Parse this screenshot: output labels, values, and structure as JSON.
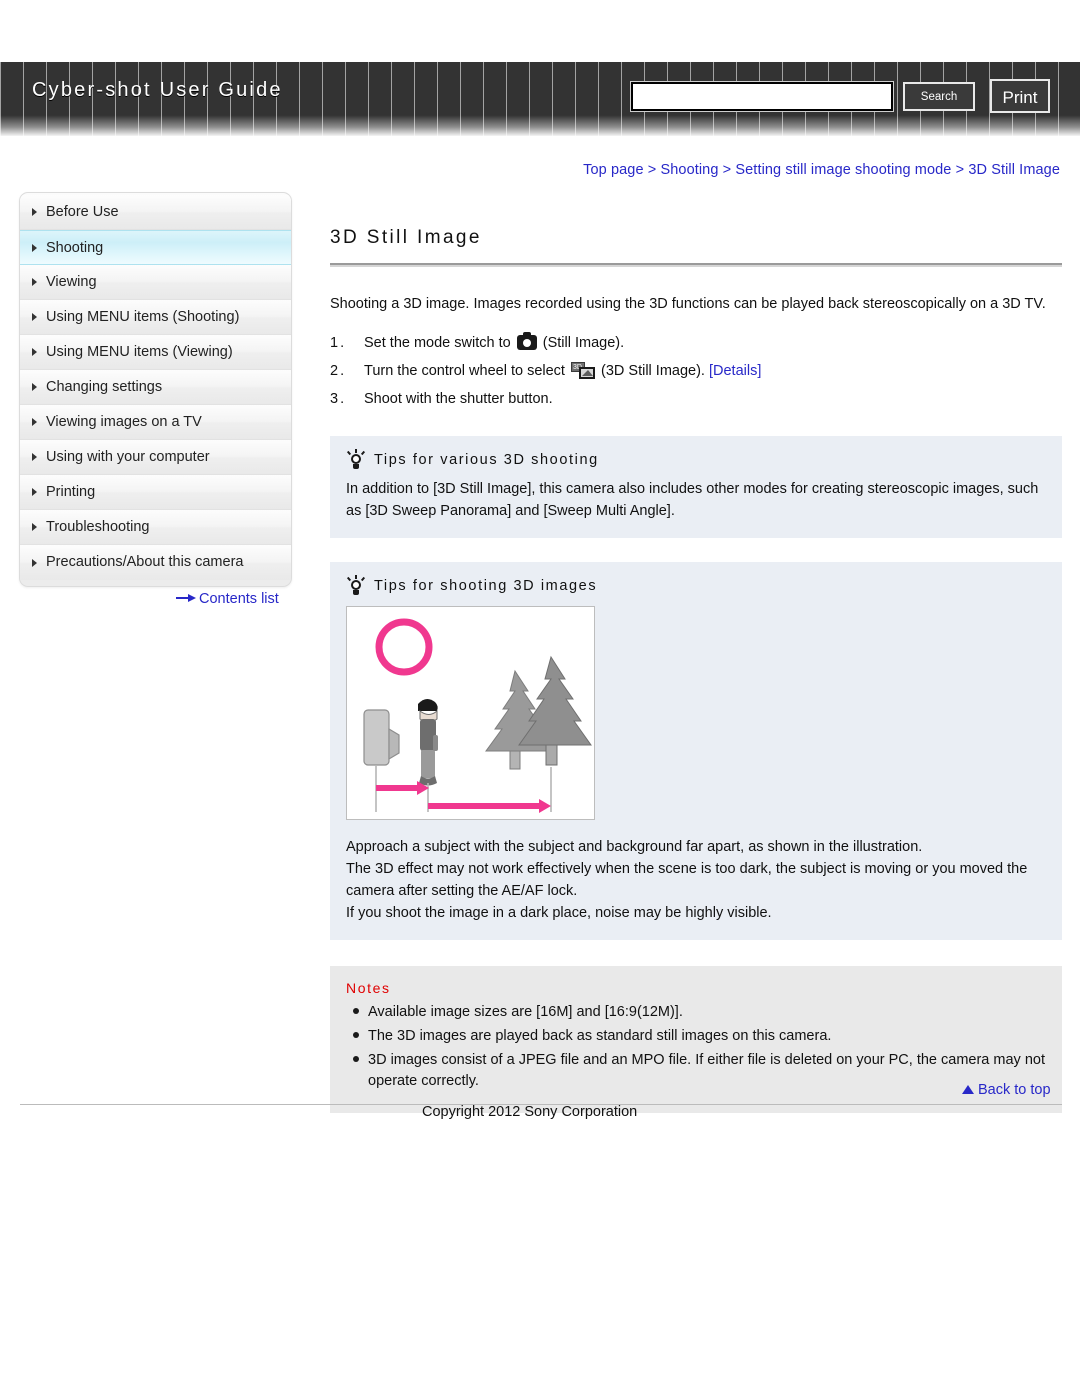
{
  "header": {
    "brand": "Cyber-shot User Guide",
    "search_value": "",
    "search_placeholder": "",
    "search_button": "Search",
    "print_button": "Print"
  },
  "breadcrumb": {
    "items": [
      "Top page",
      "Shooting",
      "Setting still image shooting mode",
      "3D Still Image"
    ],
    "separator": ">"
  },
  "sidebar": {
    "items": [
      {
        "label": "Before Use",
        "active": false
      },
      {
        "label": "Shooting",
        "active": true
      },
      {
        "label": "Viewing",
        "active": false
      },
      {
        "label": "Using MENU items (Shooting)",
        "active": false
      },
      {
        "label": "Using MENU items (Viewing)",
        "active": false
      },
      {
        "label": "Changing settings",
        "active": false
      },
      {
        "label": "Viewing images on a TV",
        "active": false
      },
      {
        "label": "Using with your computer",
        "active": false
      },
      {
        "label": "Printing",
        "active": false
      },
      {
        "label": "Troubleshooting",
        "active": false
      },
      {
        "label": "Precautions/About this camera",
        "active": false
      }
    ],
    "contents_link": "Contents list"
  },
  "main": {
    "title": "3D Still Image",
    "intro": "Shooting a 3D image. Images recorded using the 3D functions can be played back stereoscopically on a 3D TV.",
    "steps": [
      {
        "num": "1.",
        "before_icon": "Set the mode switch to ",
        "icon": "camera-icon",
        "after_icon": " (Still Image).",
        "link": ""
      },
      {
        "num": "2.",
        "before_icon": "Turn the control wheel to select ",
        "icon": "3d-still-image-icon",
        "after_icon": " (3D Still Image). ",
        "link": "[Details]"
      },
      {
        "num": "3.",
        "before_icon": "Shoot with the shutter button.",
        "icon": "",
        "after_icon": "",
        "link": ""
      }
    ],
    "tip1": {
      "heading": "Tips for various 3D shooting",
      "body": "In addition to [3D Still Image], this camera also includes other modes for creating stereoscopic images, such as [3D Sweep Panorama] and [Sweep Multi Angle]."
    },
    "tip2": {
      "heading": "Tips for shooting 3D images",
      "illustration_label": "3d-shooting-distance-illustration",
      "lines": [
        "Approach a subject with the subject and background far apart, as shown in the illustration.",
        "The 3D effect may not work effectively when the scene is too dark, the subject is moving or you moved the camera after setting the AE/AF lock.",
        "If you shoot the image in a dark place, noise may be highly visible."
      ]
    },
    "notes": {
      "title": "Notes",
      "items": [
        "Available image sizes are [16M] and [16:9(12M)].",
        "The 3D images are played back as standard still images on this camera.",
        "3D images consist of a JPEG file and an MPO file. If either file is deleted on your PC, the camera may not operate correctly."
      ]
    }
  },
  "footer": {
    "back_to_top": "Back to top",
    "copyright": "Copyright 2012 Sony Corporation"
  },
  "colors": {
    "link": "#2828c8",
    "header_bg": "#333333",
    "tip_panel_bg": "#eaeef4",
    "notes_panel_bg": "#e9e9e9",
    "notes_title": "#e00000",
    "active_nav": "#cdeff8",
    "illustration_accent": "#f0388f"
  }
}
